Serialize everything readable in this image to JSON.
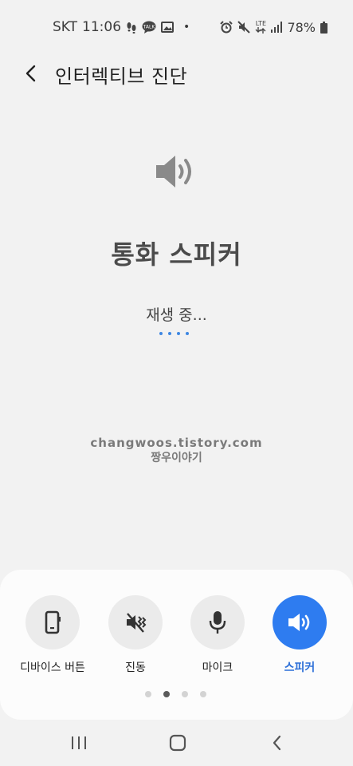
{
  "status_bar": {
    "carrier": "SKT",
    "time": "11:06",
    "separator": "•",
    "network_type": "LTE",
    "battery": "78%",
    "icons_left": [
      "footsteps-icon",
      "talk-icon",
      "gallery-icon"
    ],
    "icons_right": [
      "alarm-icon",
      "mute-icon",
      "lte-icon",
      "signal-icon",
      "battery-icon"
    ]
  },
  "header": {
    "title": "인터렉티브 진단"
  },
  "main": {
    "test_name": "통화 스피커",
    "status": "재생 중...",
    "watermark_line1": "changwoos.tistory.com",
    "watermark_line2": "짱우이야기"
  },
  "tools": [
    {
      "label": "디바이스 버튼",
      "icon": "device-button-icon",
      "active": false
    },
    {
      "label": "진동",
      "icon": "vibration-off-icon",
      "active": false
    },
    {
      "label": "마이크",
      "icon": "microphone-icon",
      "active": false
    },
    {
      "label": "스피커",
      "icon": "speaker-icon",
      "active": true
    }
  ],
  "pager": {
    "count": 4,
    "active_index": 1
  },
  "colors": {
    "accent": "#2e7cf0",
    "progress": "#3e87e2",
    "background": "#f2f2f2",
    "panel": "#fcfcfc"
  }
}
